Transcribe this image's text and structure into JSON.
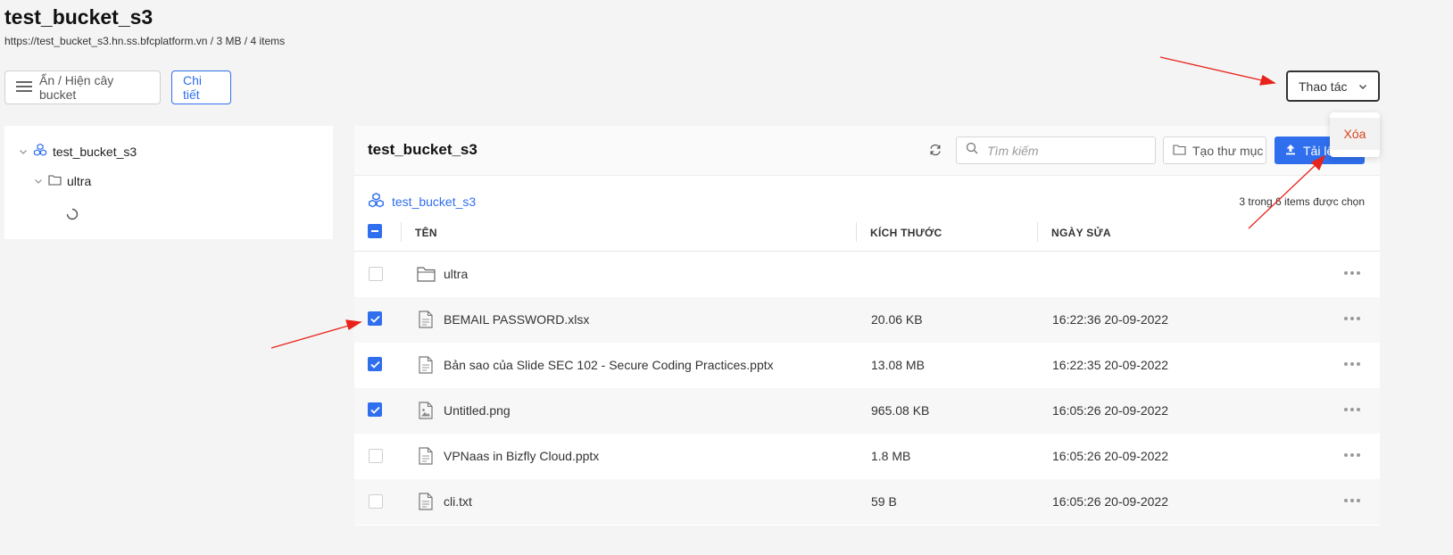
{
  "page": {
    "title": "test_bucket_s3",
    "subtitle": "https://test_bucket_s3.hn.ss.bfcplatform.vn / 3 MB / 4 items"
  },
  "toolbar": {
    "toggle_tree_label": "Ẩn / Hiện cây bucket",
    "detail_label": "Chi tiết",
    "actions_label": "Thao tác"
  },
  "dropdown": {
    "delete_label": "Xóa"
  },
  "tree": {
    "root_label": "test_bucket_s3",
    "child_label": "ultra"
  },
  "main": {
    "title": "test_bucket_s3",
    "search_placeholder": "Tìm kiếm",
    "create_folder_label": "Tạo thư mục",
    "upload_label": "Tải lên",
    "breadcrumb": "test_bucket_s3",
    "selection_text": "3 trong 6 items được chọn",
    "columns": {
      "name": "TÊN",
      "size": "KÍCH THƯỚC",
      "modified": "NGÀY SỬA"
    },
    "rows": [
      {
        "name": "ultra",
        "size": "",
        "modified": "",
        "type": "folder",
        "checked": false
      },
      {
        "name": "BEMAIL PASSWORD.xlsx",
        "size": "20.06 KB",
        "modified": "16:22:36 20-09-2022",
        "type": "file",
        "checked": true
      },
      {
        "name": "Bản sao của Slide SEC 102 - Secure Coding Practices.pptx",
        "size": "13.08 MB",
        "modified": "16:22:35 20-09-2022",
        "type": "file",
        "checked": true
      },
      {
        "name": "Untitled.png",
        "size": "965.08 KB",
        "modified": "16:05:26 20-09-2022",
        "type": "image",
        "checked": true
      },
      {
        "name": "VPNaas in Bizfly Cloud.pptx",
        "size": "1.8 MB",
        "modified": "16:05:26 20-09-2022",
        "type": "file",
        "checked": false
      },
      {
        "name": "cli.txt",
        "size": "59 B",
        "modified": "16:05:26 20-09-2022",
        "type": "file",
        "checked": false
      }
    ]
  },
  "colors": {
    "accent": "#2f6fed",
    "danger": "#d9451d",
    "annotation": "#e8231a"
  }
}
